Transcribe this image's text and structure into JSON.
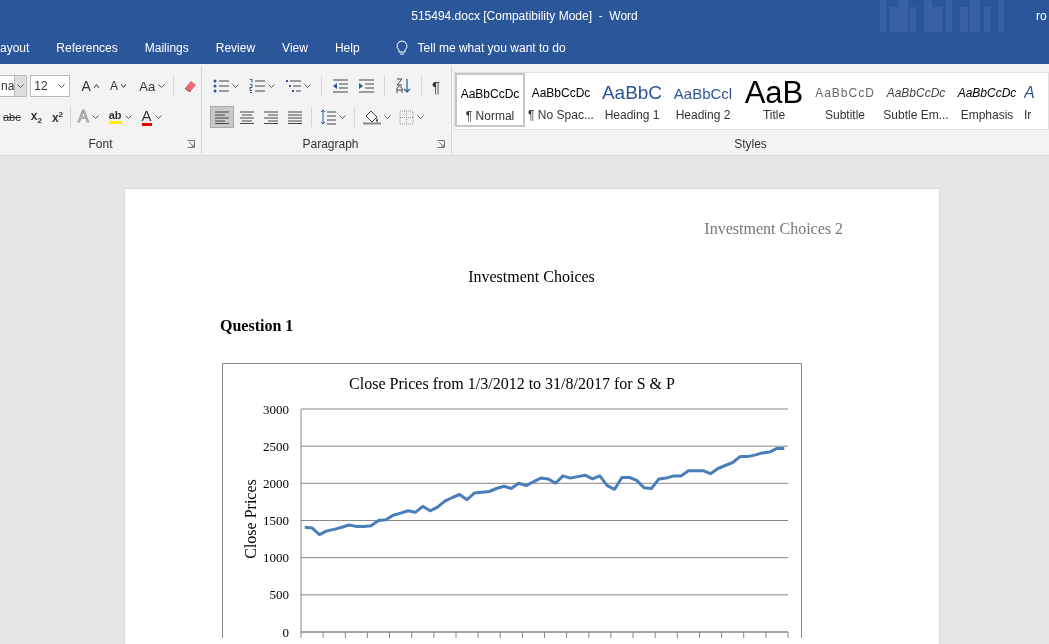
{
  "window": {
    "title": "515494.docx [Compatibility Mode]  -  Word",
    "user": "ro"
  },
  "ribbon_tabs": [
    {
      "label": "ayout",
      "selected": false
    },
    {
      "label": "References",
      "selected": false
    },
    {
      "label": "Mailings",
      "selected": false
    },
    {
      "label": "Review",
      "selected": false
    },
    {
      "label": "View",
      "selected": false
    },
    {
      "label": "Help",
      "selected": false
    }
  ],
  "tell_me": {
    "placeholder": "Tell me what you want to do"
  },
  "font_group": {
    "label": "Font",
    "font_name": "na",
    "font_size": "12",
    "buttons": [
      {
        "kind": "grow",
        "text": "A"
      },
      {
        "kind": "shrink",
        "text": "A"
      },
      {
        "kind": "case",
        "text": "Aa"
      },
      {
        "kind": "clear"
      },
      {
        "kind": "strike",
        "text": "abc"
      },
      {
        "kind": "sub",
        "text": "x$_{2}$"
      },
      {
        "kind": "sup",
        "text": "x$^{2}$"
      },
      {
        "kind": "effects",
        "text": "A"
      },
      {
        "kind": "highlight",
        "text": "ab"
      },
      {
        "kind": "color",
        "text": "A"
      }
    ]
  },
  "paragraph_group": {
    "label": "Paragraph",
    "buttons": [
      {
        "kind": "bullets"
      },
      {
        "kind": "numbering"
      },
      {
        "kind": "multilevel"
      },
      {
        "kind": "outdent"
      },
      {
        "kind": "indent"
      },
      {
        "kind": "sort"
      },
      {
        "kind": "marks",
        "text": "¶"
      },
      {
        "kind": "align-left",
        "selected": true
      },
      {
        "kind": "align-center",
        "selected": false
      },
      {
        "kind": "align-right",
        "selected": false
      },
      {
        "kind": "justify",
        "selected": false
      },
      {
        "kind": "spacing"
      },
      {
        "kind": "shading"
      },
      {
        "kind": "borders"
      }
    ]
  },
  "styles_group": {
    "label": "Styles",
    "styles": [
      {
        "kind": "normal",
        "sample": "AaBbCcDc",
        "name": "¶ Normal",
        "selected": true
      },
      {
        "kind": "no-spacing",
        "sample": "AaBbCcDc",
        "name": "¶ No Spac...",
        "selected": false
      },
      {
        "kind": "heading1",
        "sample": "AaBbC",
        "name": "Heading 1",
        "selected": false
      },
      {
        "kind": "heading2",
        "sample": "AaBbCcl",
        "name": "Heading 2",
        "selected": false
      },
      {
        "kind": "title",
        "sample": "AaB",
        "name": "Title",
        "selected": false
      },
      {
        "kind": "subtitle",
        "sample": "AaBbCcD",
        "name": "Subtitle",
        "selected": false
      },
      {
        "kind": "subtle-emphasis",
        "sample": "AaBbCcDc",
        "name": "Subtle Em...",
        "selected": false
      },
      {
        "kind": "emphasis",
        "sample": "AaBbCcDc",
        "name": "Emphasis",
        "selected": false
      },
      {
        "kind": "intense",
        "sample": "A",
        "name": "Ir",
        "selected": false
      }
    ]
  },
  "document": {
    "header": "Investment Choices 2",
    "title": "Investment Choices",
    "heading": "Question 1",
    "chart_data": {
      "type": "line",
      "title": "Close Prices from 1/3/2012 to 31/8/2017 for S & P",
      "ylabel": "Close Prices",
      "grid": true,
      "ylim": [
        0,
        3000
      ],
      "yticks": [
        0,
        500,
        1000,
        1500,
        2000,
        2500,
        3000
      ],
      "series": [
        {
          "color": "#4a7ebb",
          "values": [
            1410,
            1400,
            1310,
            1360,
            1380,
            1410,
            1440,
            1420,
            1420,
            1430,
            1500,
            1510,
            1570,
            1600,
            1630,
            1610,
            1690,
            1630,
            1680,
            1760,
            1810,
            1850,
            1780,
            1870,
            1880,
            1890,
            1930,
            1960,
            1930,
            2000,
            1970,
            2020,
            2070,
            2060,
            2000,
            2100,
            2070,
            2090,
            2110,
            2060,
            2100,
            1970,
            1920,
            2080,
            2080,
            2040,
            1940,
            1930,
            2060,
            2070,
            2100,
            2100,
            2170,
            2170,
            2170,
            2130,
            2200,
            2240,
            2280,
            2360,
            2360,
            2380,
            2410,
            2420,
            2470,
            2470
          ]
        }
      ]
    }
  }
}
